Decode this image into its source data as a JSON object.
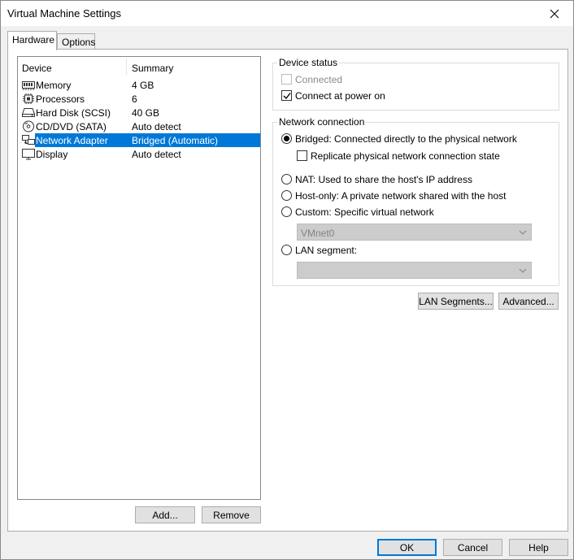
{
  "window": {
    "title": "Virtual Machine Settings"
  },
  "tabs": [
    {
      "label": "Hardware",
      "active": true
    },
    {
      "label": "Options",
      "active": false
    }
  ],
  "device_list": {
    "columns": [
      "Device",
      "Summary"
    ],
    "rows": [
      {
        "device": "Memory",
        "summary": "4 GB",
        "icon": "memory-icon"
      },
      {
        "device": "Processors",
        "summary": "6",
        "icon": "processor-icon"
      },
      {
        "device": "Hard Disk (SCSI)",
        "summary": "40 GB",
        "icon": "hard-disk-icon"
      },
      {
        "device": "CD/DVD (SATA)",
        "summary": "Auto detect",
        "icon": "cd-dvd-icon"
      },
      {
        "device": "Network Adapter",
        "summary": "Bridged (Automatic)",
        "icon": "network-adapter-icon",
        "selected": true
      },
      {
        "device": "Display",
        "summary": "Auto detect",
        "icon": "display-icon"
      }
    ]
  },
  "list_buttons": {
    "add": "Add...",
    "remove": "Remove"
  },
  "device_status": {
    "legend": "Device status",
    "connected": {
      "label": "Connected",
      "checked": false,
      "enabled": false
    },
    "connect_at_power_on": {
      "label": "Connect at power on",
      "checked": true
    }
  },
  "network_connection": {
    "legend": "Network connection",
    "bridged": "Bridged: Connected directly to the physical network",
    "replicate": "Replicate physical network connection state",
    "nat": "NAT: Used to share the host's IP address",
    "host_only": "Host-only: A private network shared with the host",
    "custom": "Custom: Specific virtual network",
    "custom_network_value": "VMnet0",
    "lan_segment": "LAN segment:",
    "lan_segment_value": "",
    "selected": "bridged"
  },
  "network_buttons": {
    "lan_segments": "LAN Segments...",
    "advanced": "Advanced..."
  },
  "dialog_buttons": {
    "ok": "OK",
    "cancel": "Cancel",
    "help": "Help"
  },
  "colors": {
    "selection": "#0078d7",
    "default_button_border": "#0078d7"
  }
}
